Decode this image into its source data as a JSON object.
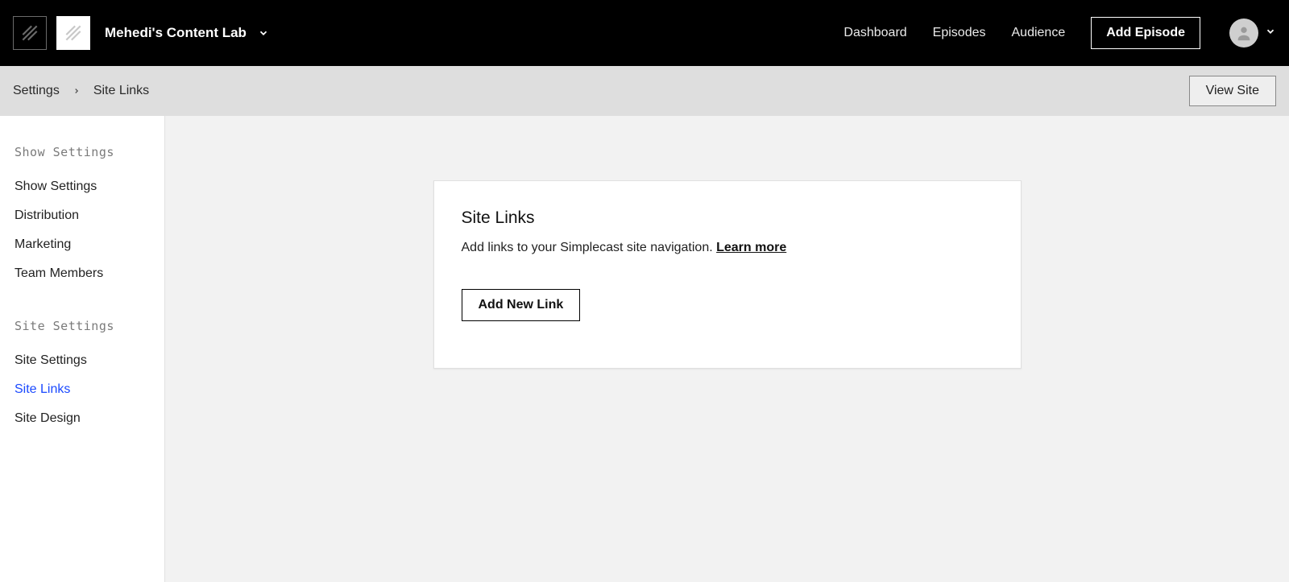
{
  "header": {
    "workspace_name": "Mehedi's Content Lab",
    "nav": {
      "dashboard": "Dashboard",
      "episodes": "Episodes",
      "audience": "Audience"
    },
    "add_episode_label": "Add Episode"
  },
  "breadcrumb": {
    "root": "Settings",
    "current": "Site Links",
    "view_site_label": "View Site"
  },
  "sidebar": {
    "group1": {
      "heading": "Show Settings",
      "items": {
        "show_settings": "Show Settings",
        "distribution": "Distribution",
        "marketing": "Marketing",
        "team_members": "Team Members"
      }
    },
    "group2": {
      "heading": "Site Settings",
      "items": {
        "site_settings": "Site Settings",
        "site_links": "Site Links",
        "site_design": "Site Design"
      }
    }
  },
  "card": {
    "title": "Site Links",
    "description": "Add links to your Simplecast site navigation. ",
    "learn_more": "Learn more",
    "add_link_label": "Add New Link"
  }
}
